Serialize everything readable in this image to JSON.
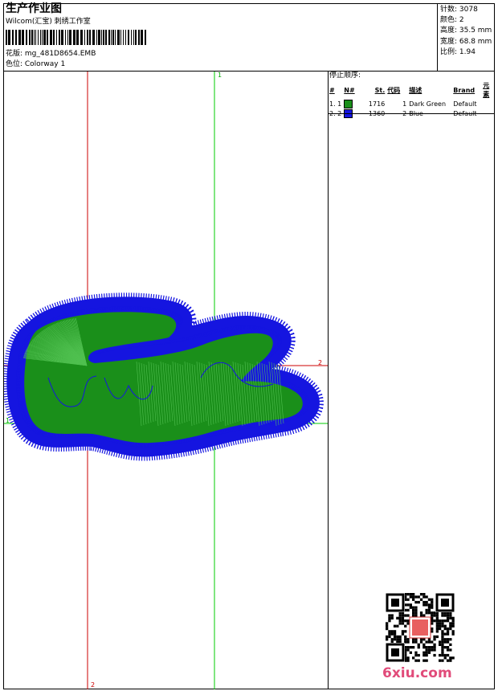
{
  "header": {
    "title": "生产作业图",
    "subtitle": "Wilcom(汇宝) 刺绣工作室",
    "design_label": "花版: mg_481D8654.EMB",
    "colorway_label": "色位: Colorway 1"
  },
  "specs": {
    "stitches": "针数: 3078",
    "colors": "颜色: 2",
    "height": "高度: 35.5 mm",
    "width": "宽度: 68.8 mm",
    "ratio": "比例: 1.94"
  },
  "stop_sequence": {
    "title": "停止顺序:",
    "columns": [
      "#",
      "N#",
      "St.",
      "代码",
      "描述",
      "Brand",
      "元素"
    ],
    "rows": [
      {
        "idx": "1. 1",
        "swatch": "#1a8f1a",
        "stitches": "1716",
        "code": "1",
        "desc": "Dark Green",
        "brand": "Default"
      },
      {
        "idx": "2. 2",
        "swatch": "#1515e0",
        "stitches": "1360",
        "code": "2",
        "desc": "Blue",
        "brand": "Default"
      }
    ]
  },
  "markers": {
    "top_green": "1",
    "right_red": "2",
    "left_green": "1",
    "bottom_red": "2"
  },
  "watermark": {
    "text": "6xiu.com"
  },
  "colors": {
    "green": "#1a8f1a",
    "blue": "#1515e0",
    "red": "#cc0000",
    "guide_green": "#00cc00"
  }
}
